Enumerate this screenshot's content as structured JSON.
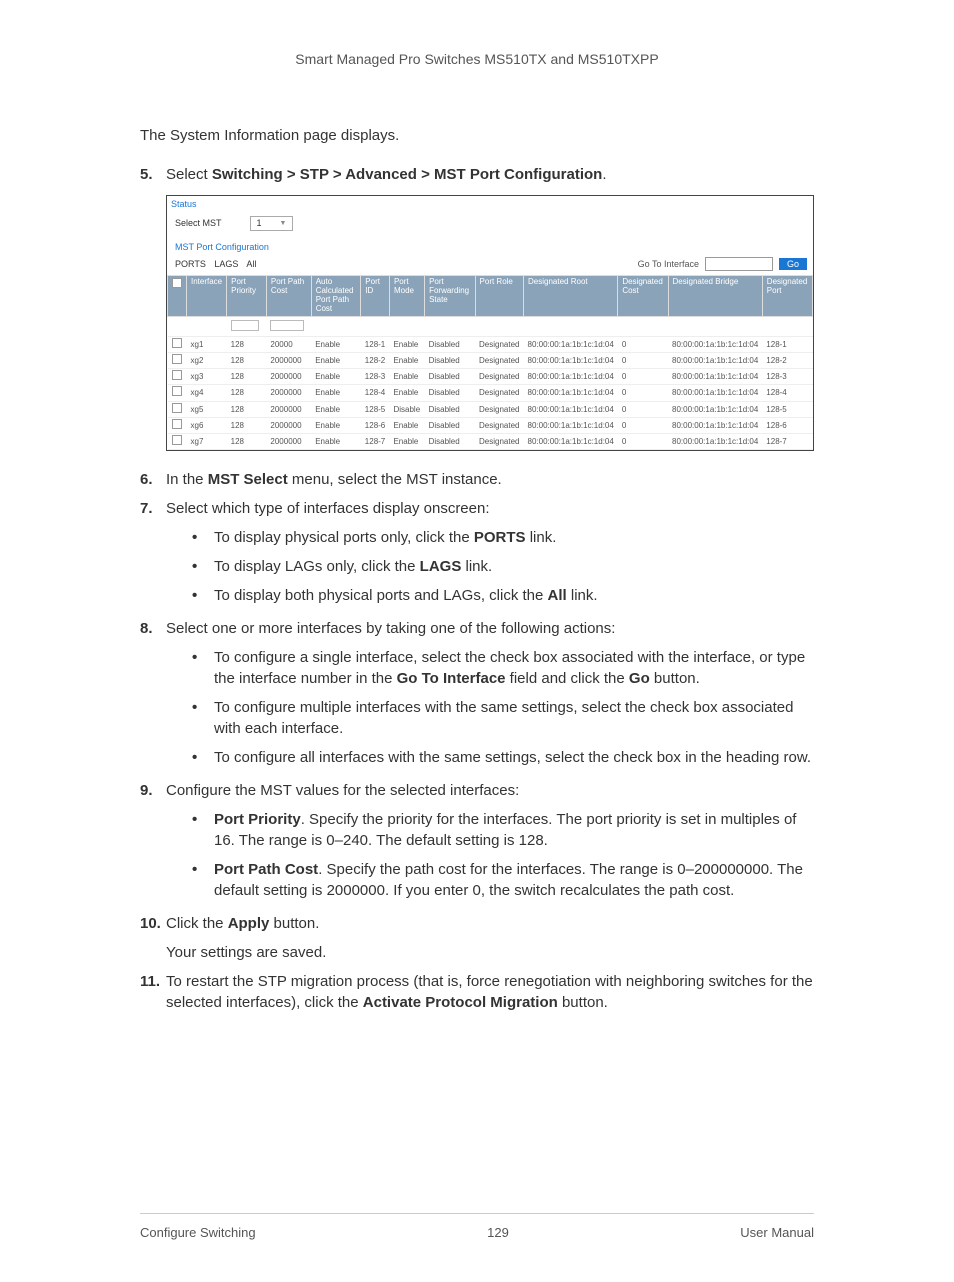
{
  "header": "Smart Managed Pro Switches MS510TX and MS510TXPP",
  "intro": "The System Information page displays.",
  "step5": {
    "num": "5.",
    "prefix": "Select ",
    "bold": "Switching > STP > Advanced > MST Port Configuration",
    "suffix": "."
  },
  "screenshot": {
    "status": "Status",
    "selectMstLabel": "Select MST",
    "selectMstValue": "1",
    "sectionTitle": "MST Port Configuration",
    "portsLabel": "PORTS",
    "lagsLabel": "LAGS",
    "allLabel": "All",
    "goToLabel": "Go To Interface",
    "goBtn": "Go",
    "headers": [
      "",
      "Interface",
      "Port Priority",
      "Port Path Cost",
      "Auto Calculated Port Path Cost",
      "Port ID",
      "Port Mode",
      "Port Forwarding State",
      "Port Role",
      "Designated Root",
      "Designated Cost",
      "Designated Bridge",
      "Designated Port"
    ],
    "rows": [
      {
        "iface": "xg1",
        "priority": "128",
        "cost": "20000",
        "auto": "Enable",
        "pid": "128-1",
        "mode": "Enable",
        "fwd": "Disabled",
        "role": "Designated",
        "droot": "80:00:00:1a:1b:1c:1d:04",
        "dcost": "0",
        "dbridge": "80:00:00:1a:1b:1c:1d:04",
        "dport": "128-1"
      },
      {
        "iface": "xg2",
        "priority": "128",
        "cost": "2000000",
        "auto": "Enable",
        "pid": "128-2",
        "mode": "Enable",
        "fwd": "Disabled",
        "role": "Designated",
        "droot": "80:00:00:1a:1b:1c:1d:04",
        "dcost": "0",
        "dbridge": "80:00:00:1a:1b:1c:1d:04",
        "dport": "128-2"
      },
      {
        "iface": "xg3",
        "priority": "128",
        "cost": "2000000",
        "auto": "Enable",
        "pid": "128-3",
        "mode": "Enable",
        "fwd": "Disabled",
        "role": "Designated",
        "droot": "80:00:00:1a:1b:1c:1d:04",
        "dcost": "0",
        "dbridge": "80:00:00:1a:1b:1c:1d:04",
        "dport": "128-3"
      },
      {
        "iface": "xg4",
        "priority": "128",
        "cost": "2000000",
        "auto": "Enable",
        "pid": "128-4",
        "mode": "Enable",
        "fwd": "Disabled",
        "role": "Designated",
        "droot": "80:00:00:1a:1b:1c:1d:04",
        "dcost": "0",
        "dbridge": "80:00:00:1a:1b:1c:1d:04",
        "dport": "128-4"
      },
      {
        "iface": "xg5",
        "priority": "128",
        "cost": "2000000",
        "auto": "Enable",
        "pid": "128-5",
        "mode": "Disable",
        "fwd": "Disabled",
        "role": "Designated",
        "droot": "80:00:00:1a:1b:1c:1d:04",
        "dcost": "0",
        "dbridge": "80:00:00:1a:1b:1c:1d:04",
        "dport": "128-5"
      },
      {
        "iface": "xg6",
        "priority": "128",
        "cost": "2000000",
        "auto": "Enable",
        "pid": "128-6",
        "mode": "Enable",
        "fwd": "Disabled",
        "role": "Designated",
        "droot": "80:00:00:1a:1b:1c:1d:04",
        "dcost": "0",
        "dbridge": "80:00:00:1a:1b:1c:1d:04",
        "dport": "128-6"
      },
      {
        "iface": "xg7",
        "priority": "128",
        "cost": "2000000",
        "auto": "Enable",
        "pid": "128-7",
        "mode": "Enable",
        "fwd": "Disabled",
        "role": "Designated",
        "droot": "80:00:00:1a:1b:1c:1d:04",
        "dcost": "0",
        "dbridge": "80:00:00:1a:1b:1c:1d:04",
        "dport": "128-7"
      }
    ]
  },
  "step6": {
    "num": "6.",
    "p1": "In the ",
    "b1": "MST Select",
    "p2": " menu, select the MST instance."
  },
  "step7": {
    "num": "7.",
    "text": "Select which type of interfaces display onscreen:"
  },
  "step7b": [
    {
      "p1": "To display physical ports only, click the ",
      "b1": "PORTS",
      "p2": " link."
    },
    {
      "p1": "To display LAGs only, click the ",
      "b1": "LAGS",
      "p2": " link."
    },
    {
      "p1": "To display both physical ports and LAGs, click the ",
      "b1": "All",
      "p2": " link."
    }
  ],
  "step8": {
    "num": "8.",
    "text": "Select one or more interfaces by taking one of the following actions:"
  },
  "step8b": [
    {
      "p1": "To configure a single interface, select the check box associated with the interface, or type the interface number in the ",
      "b1": "Go To Interface",
      "p2": " field and click the ",
      "b2": "Go",
      "p3": " button."
    },
    {
      "p1": "To configure multiple interfaces with the same settings, select the check box associated with each interface."
    },
    {
      "p1": "To configure all interfaces with the same settings, select the check box in the heading row."
    }
  ],
  "step9": {
    "num": "9.",
    "text": "Configure the MST values for the selected interfaces:"
  },
  "step9b": [
    {
      "b1": "Port Priority",
      "p1": ". Specify the priority for the interfaces. The port priority is set in multiples of 16. The range is 0–240. The default setting is 128."
    },
    {
      "b1": "Port Path Cost",
      "p1": ". Specify the path cost for the interfaces. The range is 0–200000000. The default setting is 2000000. If you enter 0, the switch recalculates the path cost."
    }
  ],
  "step10": {
    "num": "10.",
    "p1": "Click the ",
    "b1": "Apply",
    "p2": " button."
  },
  "step10a": "Your settings are saved.",
  "step11": {
    "num": "11.",
    "p1": "To restart the STP migration process (that is, force renegotiation with neighboring switches for the selected interfaces), click the ",
    "b1": "Activate Protocol Migration",
    "p2": " button."
  },
  "footer": {
    "left": "Configure Switching",
    "center": "129",
    "right": "User Manual"
  }
}
